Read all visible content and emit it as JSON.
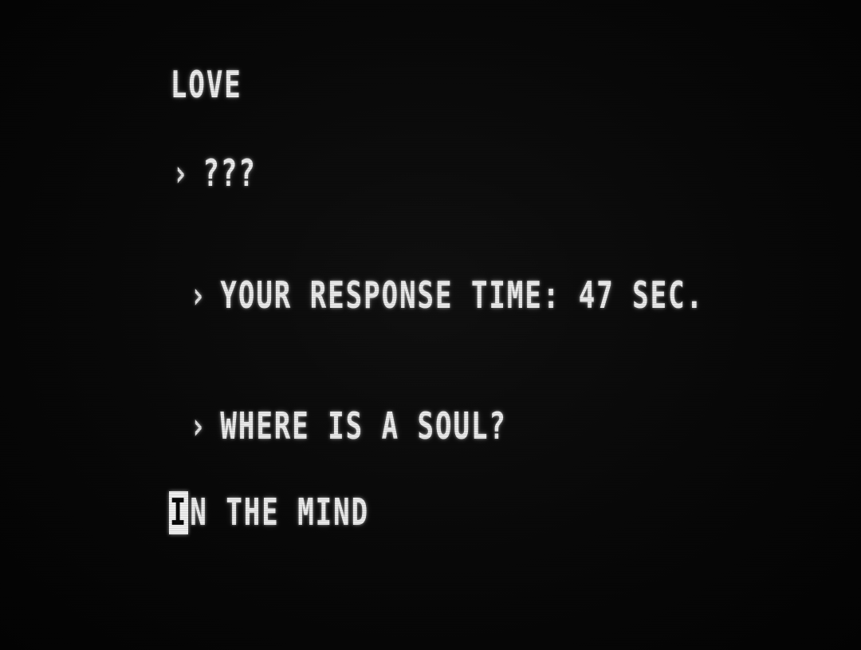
{
  "terminal": {
    "lines": [
      {
        "prompt": "",
        "text": "LOVE"
      },
      {
        "prompt": "›",
        "text": "???"
      },
      {
        "prompt": "›",
        "text": "YOUR RESPONSE TIME: 47 SEC."
      },
      {
        "prompt": "›",
        "text": "WHERE IS A SOUL?"
      }
    ],
    "input": {
      "cursor_char": "I",
      "text": "N THE MIND"
    }
  },
  "colors": {
    "background": "#060606",
    "text": "#e9e9e9"
  }
}
